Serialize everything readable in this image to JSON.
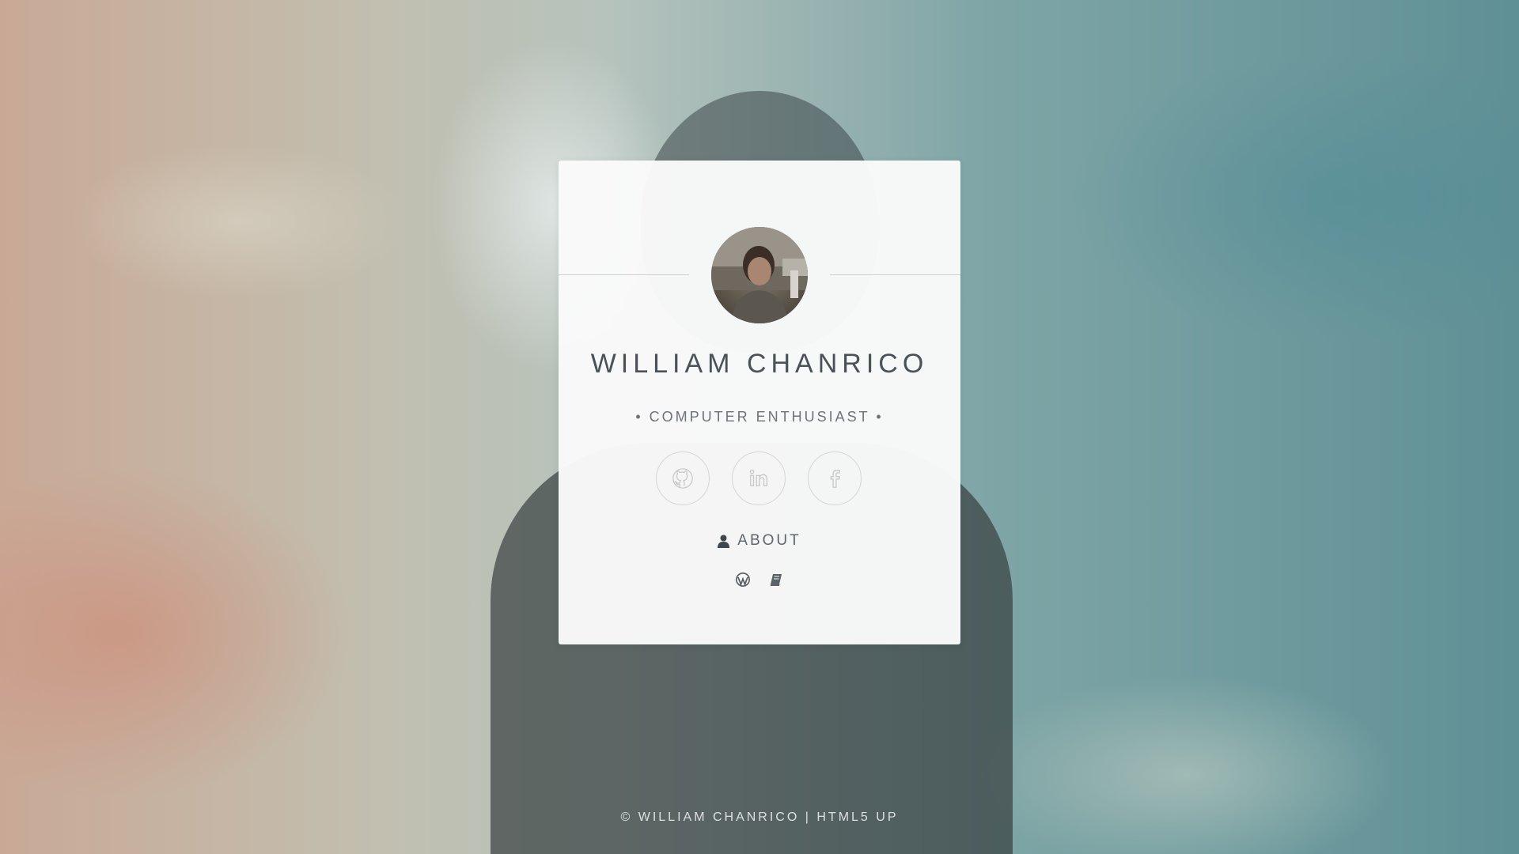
{
  "profile": {
    "name": "WILLIAM CHANRICO",
    "tagline": "• COMPUTER ENTHUSIAST •",
    "avatar_alt": "avatar"
  },
  "social": [
    {
      "icon": "github-icon"
    },
    {
      "icon": "linkedin-icon"
    },
    {
      "icon": "facebook-icon"
    }
  ],
  "about": {
    "icon": "user-icon",
    "label": "ABOUT"
  },
  "links": [
    {
      "icon": "wordpress-icon"
    },
    {
      "icon": "book-icon"
    }
  ],
  "footer": {
    "copyright": "© WILLIAM CHANRICO",
    "separator": "|",
    "credit": "HTML5 UP"
  },
  "colors": {
    "card_bg": "#fafafa",
    "name_text": "#4a5258",
    "icon_stroke": "#cccccc"
  }
}
